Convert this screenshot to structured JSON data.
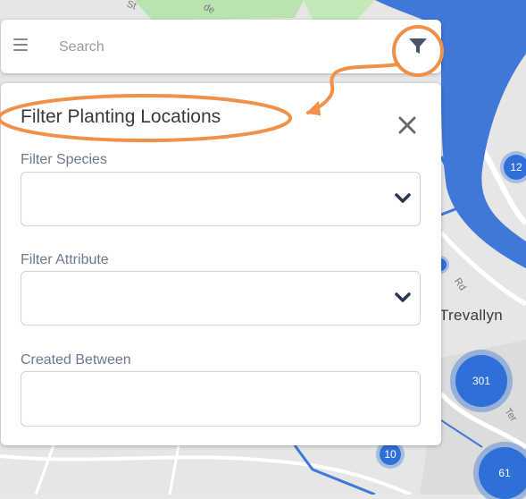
{
  "map": {
    "suburb_label": "Trevallyn",
    "road_labels": {
      "st": "St",
      "de": "de",
      "rd": "Rd",
      "ter": "Ter"
    },
    "clusters": {
      "c12": "12",
      "c301": "301",
      "c10": "10",
      "c61": "61"
    },
    "water_color": "#3f78d8",
    "park_color": "#b9e4b0"
  },
  "search": {
    "placeholder": "Search",
    "menu_icon": "hamburger-menu-icon",
    "filter_icon": "funnel-filter-icon"
  },
  "filter_panel": {
    "title": "Filter Planting Locations",
    "close_icon": "close-x-icon",
    "species_label": "Filter Species",
    "attribute_label": "Filter Attribute",
    "created_label": "Created Between",
    "chevron_icon": "chevron-down-icon"
  },
  "annotation": {
    "color": "#f0914a",
    "description": "highlight-circle-and-arrow"
  }
}
